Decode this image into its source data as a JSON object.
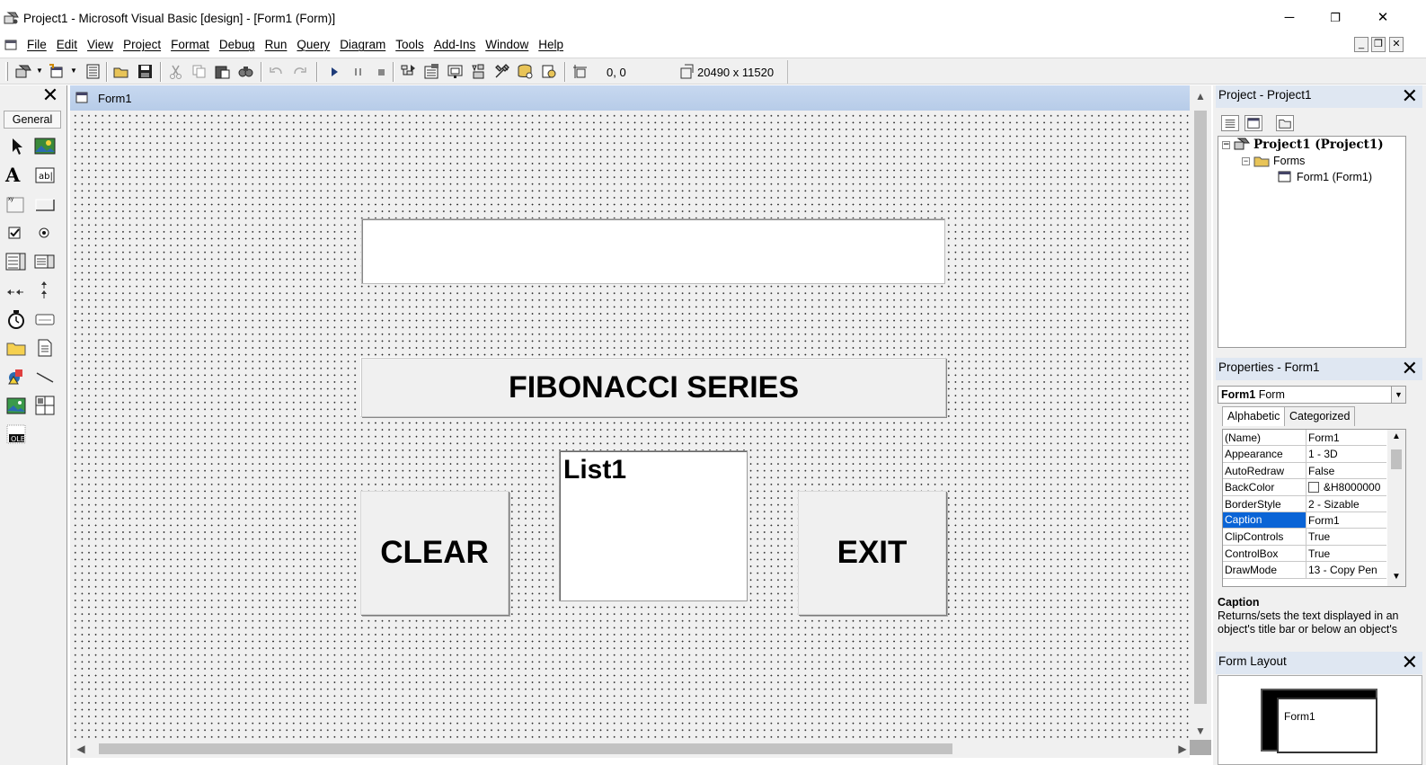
{
  "window": {
    "title": "Project1 - Microsoft Visual Basic [design] - [Form1 (Form)]",
    "minimize": "─",
    "restore": "❐",
    "close": "✕"
  },
  "menu": {
    "items": [
      "File",
      "Edit",
      "View",
      "Project",
      "Format",
      "Debug",
      "Run",
      "Query",
      "Diagram",
      "Tools",
      "Add-Ins",
      "Window",
      "Help"
    ],
    "mdi_min": "_",
    "mdi_restore": "❐",
    "mdi_close": "✕"
  },
  "toolbar": {
    "coordinates": "0, 0",
    "size": "20490 x 11520"
  },
  "toolbox": {
    "close": "✕",
    "tab": "General"
  },
  "form": {
    "title": "Form1",
    "label_caption": "FIBONACCI SERIES",
    "clear_caption": "CLEAR",
    "exit_caption": "EXIT",
    "list_text": "List1"
  },
  "project_panel": {
    "title": "Project - Project1",
    "close": "✕",
    "tree": {
      "project": "Project1 (Project1)",
      "forms": "Forms",
      "form": "Form1 (Form1)"
    }
  },
  "properties_panel": {
    "title": "Properties - Form1",
    "close": "✕",
    "object_name": "Form1",
    "object_type": "Form",
    "tabs": [
      "Alphabetic",
      "Categorized"
    ],
    "rows": [
      {
        "name": "(Name)",
        "value": "Form1"
      },
      {
        "name": "Appearance",
        "value": "1 - 3D"
      },
      {
        "name": "AutoRedraw",
        "value": "False"
      },
      {
        "name": "BackColor",
        "value": "&H8000000"
      },
      {
        "name": "BorderStyle",
        "value": "2 - Sizable"
      },
      {
        "name": "Caption",
        "value": "Form1"
      },
      {
        "name": "ClipControls",
        "value": "True"
      },
      {
        "name": "ControlBox",
        "value": "True"
      },
      {
        "name": "DrawMode",
        "value": "13 - Copy Pen"
      }
    ],
    "selected_row": "Caption",
    "description_title": "Caption",
    "description_text": "Returns/sets the text displayed in an object's title bar or below an object's"
  },
  "layout_panel": {
    "title": "Form Layout",
    "close": "✕",
    "form_label": "Form1"
  },
  "colors": {
    "selection": "#0a64d6",
    "form_titlebar": "#c7d8f0",
    "face": "#f0f0f0"
  }
}
